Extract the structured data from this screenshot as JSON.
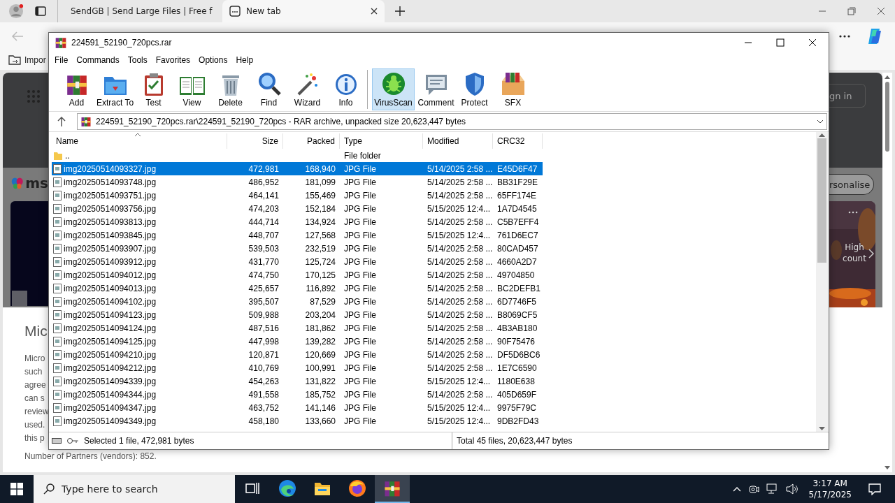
{
  "browser": {
    "tabs": [
      {
        "title": "SendGB | Send Large Files | Free f",
        "kind": "site",
        "selected": false
      },
      {
        "title": "New tab",
        "kind": "newtab",
        "selected": true
      }
    ],
    "favorites_bar": {
      "item": "Impor"
    }
  },
  "page": {
    "logo_text": "ms",
    "sign_in": "gn in",
    "personalise": "rsonalise",
    "card_text": "High count",
    "heading": "Mic",
    "paragraph_lines": [
      "Micro",
      "such",
      "agree",
      "can s",
      "review",
      "used.",
      "this p"
    ],
    "footer": "Number of Partners (vendors): 852."
  },
  "winrar": {
    "title": "224591_52190_720pcs.rar",
    "menu": [
      "File",
      "Commands",
      "Tools",
      "Favorites",
      "Options",
      "Help"
    ],
    "toolbar": [
      {
        "label": "Add",
        "kind": "add",
        "highlighted": false
      },
      {
        "label": "Extract To",
        "kind": "extract",
        "highlighted": false
      },
      {
        "label": "Test",
        "kind": "test",
        "highlighted": false
      },
      {
        "label": "View",
        "kind": "view",
        "highlighted": false
      },
      {
        "label": "Delete",
        "kind": "delete",
        "highlighted": false
      },
      {
        "label": "Find",
        "kind": "find",
        "highlighted": false
      },
      {
        "label": "Wizard",
        "kind": "wizard",
        "highlighted": false
      },
      {
        "label": "Info",
        "kind": "info",
        "highlighted": false
      },
      {
        "label": "VirusScan",
        "kind": "virusscan",
        "highlighted": true
      },
      {
        "label": "Comment",
        "kind": "comment",
        "highlighted": false
      },
      {
        "label": "Protect",
        "kind": "protect",
        "highlighted": false
      },
      {
        "label": "SFX",
        "kind": "sfx",
        "highlighted": false
      }
    ],
    "path": "224591_52190_720pcs.rar\\224591_52190_720pcs - RAR archive, unpacked size 20,623,447 bytes",
    "columns": [
      {
        "label": "Name",
        "sorted": true
      },
      {
        "label": "Size",
        "sorted": false
      },
      {
        "label": "Packed",
        "sorted": false
      },
      {
        "label": "Type",
        "sorted": false
      },
      {
        "label": "Modified",
        "sorted": false
      },
      {
        "label": "CRC32",
        "sorted": false
      }
    ],
    "rows": [
      {
        "kind": "folder",
        "name": "..",
        "size": "",
        "packed": "",
        "type": "File folder",
        "modified": "",
        "crc": "",
        "selected": false
      },
      {
        "kind": "file",
        "name": "img20250514093327.jpg",
        "size": "472,981",
        "packed": "168,940",
        "type": "JPG File",
        "modified": "5/14/2025 2:58 ...",
        "crc": "E45D6F47",
        "selected": true
      },
      {
        "kind": "file",
        "name": "img20250514093748.jpg",
        "size": "486,952",
        "packed": "181,099",
        "type": "JPG File",
        "modified": "5/14/2025 2:58 ...",
        "crc": "BB31F29E",
        "selected": false
      },
      {
        "kind": "file",
        "name": "img20250514093751.jpg",
        "size": "464,141",
        "packed": "155,469",
        "type": "JPG File",
        "modified": "5/14/2025 2:58 ...",
        "crc": "65FF174E",
        "selected": false
      },
      {
        "kind": "file",
        "name": "img20250514093756.jpg",
        "size": "474,203",
        "packed": "152,184",
        "type": "JPG File",
        "modified": "5/15/2025 12:4...",
        "crc": "1A7D4545",
        "selected": false
      },
      {
        "kind": "file",
        "name": "img20250514093813.jpg",
        "size": "444,714",
        "packed": "134,924",
        "type": "JPG File",
        "modified": "5/14/2025 2:58 ...",
        "crc": "C5B7EFF4",
        "selected": false
      },
      {
        "kind": "file",
        "name": "img20250514093845.jpg",
        "size": "448,707",
        "packed": "127,568",
        "type": "JPG File",
        "modified": "5/15/2025 12:4...",
        "crc": "761D6EC7",
        "selected": false
      },
      {
        "kind": "file",
        "name": "img20250514093907.jpg",
        "size": "539,503",
        "packed": "232,519",
        "type": "JPG File",
        "modified": "5/14/2025 2:58 ...",
        "crc": "80CAD457",
        "selected": false
      },
      {
        "kind": "file",
        "name": "img20250514093912.jpg",
        "size": "431,770",
        "packed": "125,724",
        "type": "JPG File",
        "modified": "5/14/2025 2:58 ...",
        "crc": "4660A2D7",
        "selected": false
      },
      {
        "kind": "file",
        "name": "img20250514094012.jpg",
        "size": "474,750",
        "packed": "170,125",
        "type": "JPG File",
        "modified": "5/14/2025 2:58 ...",
        "crc": "49704850",
        "selected": false
      },
      {
        "kind": "file",
        "name": "img20250514094013.jpg",
        "size": "425,657",
        "packed": "116,892",
        "type": "JPG File",
        "modified": "5/14/2025 2:58 ...",
        "crc": "BC2DEFB1",
        "selected": false
      },
      {
        "kind": "file",
        "name": "img20250514094102.jpg",
        "size": "395,507",
        "packed": "87,529",
        "type": "JPG File",
        "modified": "5/14/2025 2:58 ...",
        "crc": "6D7746F5",
        "selected": false
      },
      {
        "kind": "file",
        "name": "img20250514094123.jpg",
        "size": "509,988",
        "packed": "203,204",
        "type": "JPG File",
        "modified": "5/14/2025 2:58 ...",
        "crc": "B8069CF5",
        "selected": false
      },
      {
        "kind": "file",
        "name": "img20250514094124.jpg",
        "size": "487,516",
        "packed": "181,862",
        "type": "JPG File",
        "modified": "5/14/2025 2:58 ...",
        "crc": "4B3AB180",
        "selected": false
      },
      {
        "kind": "file",
        "name": "img20250514094125.jpg",
        "size": "447,998",
        "packed": "139,282",
        "type": "JPG File",
        "modified": "5/14/2025 2:58 ...",
        "crc": "90F75476",
        "selected": false
      },
      {
        "kind": "file",
        "name": "img20250514094210.jpg",
        "size": "120,871",
        "packed": "120,669",
        "type": "JPG File",
        "modified": "5/14/2025 2:58 ...",
        "crc": "DF5D6BC6",
        "selected": false
      },
      {
        "kind": "file",
        "name": "img20250514094212.jpg",
        "size": "410,769",
        "packed": "100,991",
        "type": "JPG File",
        "modified": "5/14/2025 2:58 ...",
        "crc": "1E7C6590",
        "selected": false
      },
      {
        "kind": "file",
        "name": "img20250514094339.jpg",
        "size": "454,263",
        "packed": "131,822",
        "type": "JPG File",
        "modified": "5/15/2025 12:4...",
        "crc": "1180E638",
        "selected": false
      },
      {
        "kind": "file",
        "name": "img20250514094344.jpg",
        "size": "491,558",
        "packed": "185,752",
        "type": "JPG File",
        "modified": "5/14/2025 2:58 ...",
        "crc": "405D659F",
        "selected": false
      },
      {
        "kind": "file",
        "name": "img20250514094347.jpg",
        "size": "463,752",
        "packed": "141,146",
        "type": "JPG File",
        "modified": "5/15/2025 12:4...",
        "crc": "9975F79C",
        "selected": false
      },
      {
        "kind": "file",
        "name": "img20250514094349.jpg",
        "size": "458,180",
        "packed": "133,660",
        "type": "JPG File",
        "modified": "5/15/2025 12:4...",
        "crc": "9DB2FD43",
        "selected": false
      }
    ],
    "status_left": "Selected 1 file, 472,981 bytes",
    "status_right": "Total 45 files, 20,623,447 bytes"
  },
  "taskbar": {
    "search_placeholder": "Type here to search",
    "apps": [
      {
        "kind": "taskview",
        "active": false
      },
      {
        "kind": "edge",
        "active": false
      },
      {
        "kind": "explorer",
        "active": false
      },
      {
        "kind": "firefox",
        "active": false
      },
      {
        "kind": "winrar",
        "active": true
      }
    ],
    "time": "3:17 AM",
    "date": "5/17/2025"
  }
}
